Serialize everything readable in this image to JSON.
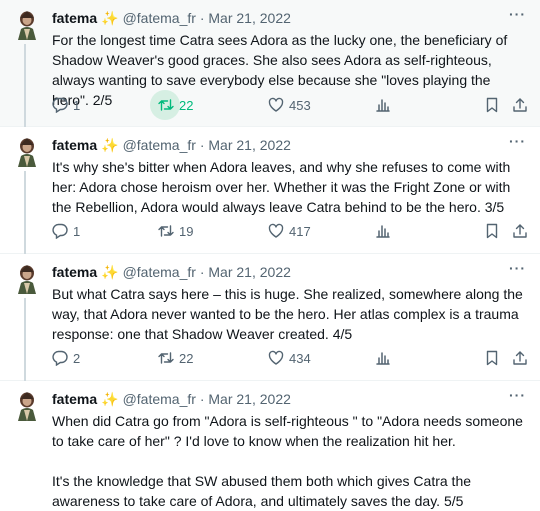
{
  "colors": {
    "text": "#0f1419",
    "muted": "#536471",
    "retweet_active": "#00ba7c",
    "sparkle": "#f4b400",
    "selected_bg": "#f7f9f9"
  },
  "author": {
    "name": "fatema",
    "badge": "✨",
    "handle": "@fatema_fr",
    "separator": "·",
    "date": "Mar 21, 2022"
  },
  "tweets": [
    {
      "paragraphs": [
        "For the longest time Catra sees Adora as the lucky one, the beneficiary of Shadow Weaver's good graces. She also sees Adora as self-righteous, always wanting to save everybody else because she \"loves playing the hero\". 2/5"
      ],
      "replies": "1",
      "retweets": "22",
      "likes": "453",
      "retweeted": true
    },
    {
      "paragraphs": [
        "It's why she's bitter when Adora leaves, and why she refuses to come with her: Adora chose heroism over her. Whether it was the Fright Zone or with the Rebellion, Adora would always leave Catra behind to be the hero. 3/5"
      ],
      "replies": "1",
      "retweets": "19",
      "likes": "417",
      "retweeted": false
    },
    {
      "paragraphs": [
        "But what Catra says here – this is huge. She realized, somewhere along the way, that Adora never wanted to be the hero. Her atlas complex is a trauma response: one that Shadow Weaver created. 4/5"
      ],
      "replies": "2",
      "retweets": "22",
      "likes": "434",
      "retweeted": false
    },
    {
      "paragraphs": [
        "When did Catra go from \"Adora is self-righteous \" to \"Adora needs someone to take care of her\" ? I'd love to know when the realization hit her.",
        "It's the knowledge that SW abused them both which gives Catra the awareness to take care of Adora, and ultimately saves the day. 5/5"
      ]
    }
  ]
}
